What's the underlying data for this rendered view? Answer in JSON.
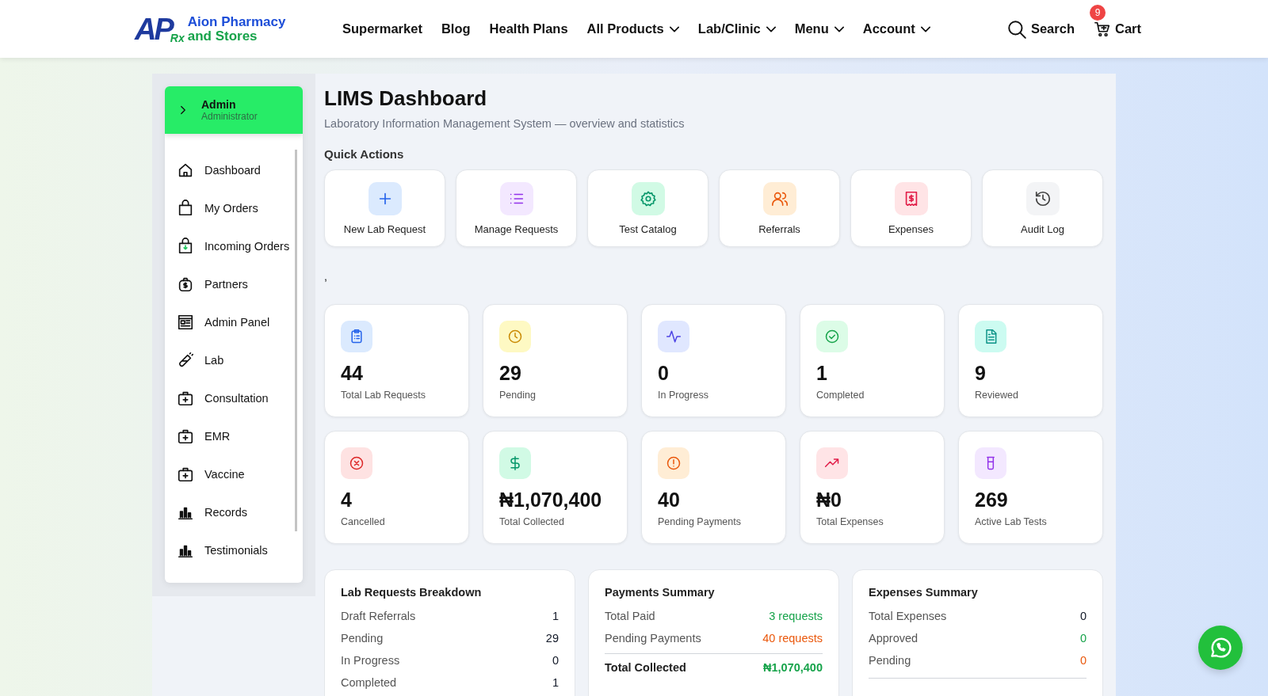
{
  "header": {
    "logo": {
      "mark": "AP",
      "sub": "Rx",
      "line1": "Aion Pharmacy",
      "line2": "and Stores"
    },
    "nav": [
      {
        "label": "Supermarket",
        "dropdown": false
      },
      {
        "label": "Blog",
        "dropdown": false
      },
      {
        "label": "Health Plans",
        "dropdown": false
      },
      {
        "label": "All Products",
        "dropdown": true
      },
      {
        "label": "Lab/Clinic",
        "dropdown": true
      },
      {
        "label": "Menu",
        "dropdown": true
      },
      {
        "label": "Account",
        "dropdown": true
      }
    ],
    "search": "Search",
    "cart": {
      "label": "Cart",
      "badge": "9"
    }
  },
  "sidebar": {
    "user": {
      "name": "Admin",
      "role": "Administrator"
    },
    "items": [
      {
        "label": "Dashboard",
        "kind": "home"
      },
      {
        "label": "My Orders",
        "kind": "bag"
      },
      {
        "label": "Incoming Orders",
        "kind": "bag-in"
      },
      {
        "label": "Partners",
        "kind": "money"
      },
      {
        "label": "Admin Panel",
        "kind": "panel"
      },
      {
        "label": "Lab",
        "kind": "tube"
      },
      {
        "label": "Consultation",
        "kind": "kit"
      },
      {
        "label": "EMR",
        "kind": "kit"
      },
      {
        "label": "Vaccine",
        "kind": "kit"
      },
      {
        "label": "Records",
        "kind": "chart"
      },
      {
        "label": "Testimonials",
        "kind": "chart"
      }
    ]
  },
  "page": {
    "title": "LIMS Dashboard",
    "subtitle": "Laboratory Information Management System — overview and statistics",
    "quick_actions_title": "Quick Actions",
    "stray_text": ","
  },
  "quick_actions": [
    {
      "label": "New Lab Request",
      "kind": "plus"
    },
    {
      "label": "Manage Requests",
      "kind": "list"
    },
    {
      "label": "Test Catalog",
      "kind": "gear"
    },
    {
      "label": "Referrals",
      "kind": "users"
    },
    {
      "label": "Expenses",
      "kind": "receipt"
    },
    {
      "label": "Audit Log",
      "kind": "history"
    }
  ],
  "stats": [
    {
      "value": "44",
      "label": "Total Lab Requests",
      "kind": "clipboard"
    },
    {
      "value": "29",
      "label": "Pending",
      "kind": "clock"
    },
    {
      "value": "0",
      "label": "In Progress",
      "kind": "pulse"
    },
    {
      "value": "1",
      "label": "Completed",
      "kind": "check"
    },
    {
      "value": "9",
      "label": "Reviewed",
      "kind": "doc"
    },
    {
      "value": "4",
      "label": "Cancelled",
      "kind": "x"
    },
    {
      "value": "₦1,070,400",
      "label": "Total Collected",
      "kind": "dollar"
    },
    {
      "value": "40",
      "label": "Pending Payments",
      "kind": "alert"
    },
    {
      "value": "₦0",
      "label": "Total Expenses",
      "kind": "trend"
    },
    {
      "value": "269",
      "label": "Active Lab Tests",
      "kind": "beaker"
    }
  ],
  "summaries": [
    {
      "title": "Lab Requests Breakdown",
      "rows": [
        {
          "kind": "row",
          "label": "Draft Referrals",
          "value": "1",
          "color": "#111827"
        },
        {
          "kind": "row",
          "label": "Pending",
          "value": "29",
          "color": "#111827"
        },
        {
          "kind": "row",
          "label": "In Progress",
          "value": "0",
          "color": "#111827"
        },
        {
          "kind": "row",
          "label": "Completed",
          "value": "1",
          "color": "#111827"
        }
      ]
    },
    {
      "title": "Payments Summary",
      "rows": [
        {
          "kind": "row",
          "label": "Total Paid",
          "value": "3 requests",
          "color": "#16a34a"
        },
        {
          "kind": "row",
          "label": "Pending Payments",
          "value": "40 requests",
          "color": "#ea580c"
        },
        {
          "kind": "total",
          "label": "Total Collected",
          "value": "₦1,070,400",
          "color": "#16a34a"
        }
      ]
    },
    {
      "title": "Expenses Summary",
      "rows": [
        {
          "kind": "row",
          "label": "Total Expenses",
          "value": "0",
          "color": "#111827"
        },
        {
          "kind": "row",
          "label": "Approved",
          "value": "0",
          "color": "#16a34a"
        },
        {
          "kind": "row",
          "label": "Pending",
          "value": "0",
          "color": "#ea580c"
        },
        {
          "kind": "divider"
        }
      ]
    }
  ]
}
